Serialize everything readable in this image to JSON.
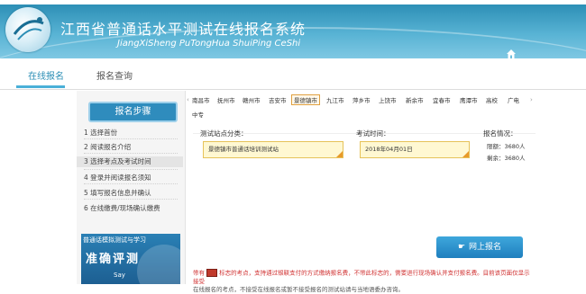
{
  "header": {
    "title_cn": "江西省普通话水平测试在线报名系统",
    "title_en": "JiangXiSheng PuTongHua ShuiPing CeShi"
  },
  "nav": {
    "items": [
      {
        "label": "在线报名",
        "active": true
      },
      {
        "label": "报名查询",
        "active": false
      }
    ]
  },
  "sidebar": {
    "title": "报名步骤",
    "steps": [
      {
        "label": "1 选择首份"
      },
      {
        "label": "2 阅读报名介绍"
      },
      {
        "label": "3 选择考点及考试时间"
      },
      {
        "label": "4 登录并阅读报名须知"
      },
      {
        "label": "5 填写报名信息并确认"
      },
      {
        "label": "6 在线缴费/现场确认缴费"
      }
    ],
    "banner": {
      "top": "普通话模拟测试与学习",
      "big": "准确评测",
      "bottom": "Say"
    }
  },
  "cities": {
    "items": [
      {
        "label": "南昌市"
      },
      {
        "label": "抚州市"
      },
      {
        "label": "赣州市"
      },
      {
        "label": "吉安市"
      },
      {
        "label": "景德镇市",
        "active": true
      },
      {
        "label": "九江市"
      },
      {
        "label": "萍乡市"
      },
      {
        "label": "上饶市"
      },
      {
        "label": "新余市"
      },
      {
        "label": "宜春市"
      },
      {
        "label": "鹰潭市"
      },
      {
        "label": "高校"
      },
      {
        "label": "广电"
      },
      {
        "label": "中专"
      }
    ]
  },
  "form": {
    "site_label": "测试站点分类：",
    "site_value": "景德镇市普通话培训测试站",
    "date_label": "考试时间：",
    "date_value": "2018年04月01日",
    "status_label": "报名情况：",
    "status_rows": [
      {
        "label": "限额：",
        "value": "3680人"
      },
      {
        "label": "剩余：",
        "value": "3680人"
      }
    ]
  },
  "apply_button": "网上报名",
  "note": {
    "line1_prefix": "带有",
    "line1_rest": "标志的考点，支持通过银联支付的方式缴纳报名费，不带此标志的，需要进行现场确认并支付报名费。目前该页面仅显示接受",
    "line2": "在线报名的考点，不接受在线报名或暂不接受报名的测试站请与当地语委办咨询。"
  }
}
